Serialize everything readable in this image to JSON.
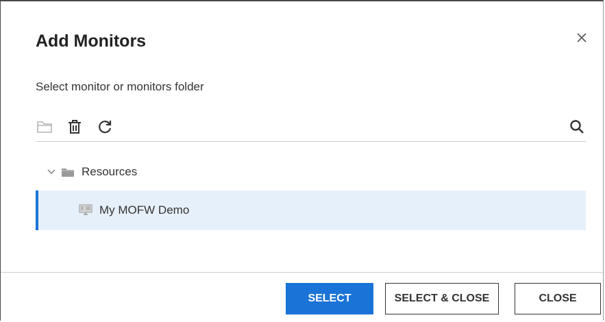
{
  "dialog": {
    "title": "Add Monitors",
    "subtitle": "Select monitor or monitors folder",
    "close_icon": "close-icon"
  },
  "toolbar": {
    "icons": [
      "folder-icon",
      "trash-icon",
      "refresh-icon",
      "search-icon"
    ]
  },
  "tree": {
    "folder": {
      "label": "Resources",
      "expanded": true,
      "icon": "folder-icon"
    },
    "items": [
      {
        "label": "My MOFW Demo",
        "selected": true,
        "icon": "monitor-icon"
      }
    ]
  },
  "buttons": {
    "select": "SELECT",
    "select_close": "SELECT & CLOSE",
    "close": "CLOSE"
  },
  "colors": {
    "primary": "#1a73d6",
    "selected_row": "#e6f0fa"
  }
}
